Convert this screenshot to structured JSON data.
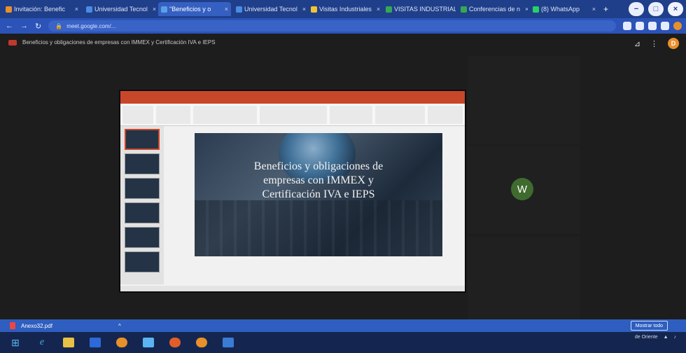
{
  "browser": {
    "tabs": [
      {
        "label": "Invitación: Benefic",
        "color": "#e8902a",
        "active": false
      },
      {
        "label": "Universidad Tecnol",
        "color": "#4a8be6",
        "active": false
      },
      {
        "label": "\"Beneficios y o",
        "color": "#5aa0e6",
        "active": true
      },
      {
        "label": "Universidad Tecnol",
        "color": "#4a8be6",
        "active": false
      },
      {
        "label": "Visitas Industriales",
        "color": "#f1c232",
        "active": false
      },
      {
        "label": "VISITAS INDUSTRIALE",
        "color": "#34a853",
        "active": false
      },
      {
        "label": "Conferencias de n",
        "color": "#34a853",
        "active": false
      },
      {
        "label": "(8) WhatsApp",
        "color": "#25d366",
        "active": false
      }
    ],
    "tab_close": "×",
    "new_tab": "+",
    "url": "meet.google.com/...",
    "window_controls": {
      "minimize": "−",
      "maximize": "□",
      "close": "×"
    }
  },
  "meet": {
    "presentation_title": "Beneficios y obligaciones de empresas con IMMEX y Certificación IVA e IEPS"
  },
  "slide": {
    "title_lines": [
      "Beneficios y obligaciones de",
      "empresas con IMMEX y",
      "Certificación IVA e IEPS"
    ]
  },
  "participant": {
    "initial": "W"
  },
  "downloads": {
    "file": "Anexo32.pdf",
    "caret": "^",
    "show_all": "Mostrar todo"
  },
  "taskbar": {
    "start": "⊞",
    "ie": "e",
    "tray_text": "de Oriente"
  },
  "colors": {
    "accent_blue": "#2e5ebf",
    "ppt_orange": "#c8472a",
    "avatar_green": "#3f6b2f"
  }
}
